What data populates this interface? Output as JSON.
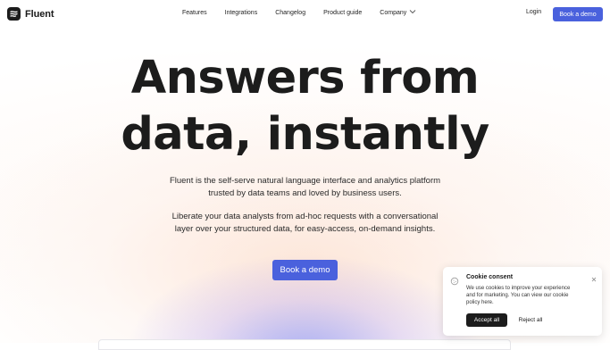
{
  "brand": {
    "name": "Fluent"
  },
  "nav": {
    "links": [
      "Features",
      "Integrations",
      "Changelog",
      "Product guide",
      "Company"
    ],
    "login": "Login",
    "cta": "Book a demo"
  },
  "hero": {
    "title_lines": [
      "Answers from",
      "data, instantly"
    ],
    "paragraph1_lines": [
      "Fluent is the self-serve natural language interface and analytics platform",
      "trusted by data teams and loved by business users."
    ],
    "paragraph2_lines": [
      "Liberate your data analysts from ad-hoc requests with a conversational",
      "layer over your structured data, for easy-access, on-demand insights."
    ],
    "cta": "Book a demo"
  },
  "cookie": {
    "title": "Cookie consent",
    "text_lines": [
      "We use cookies to improve your experience",
      "and for marketing. You can view our cookie",
      "policy here."
    ],
    "accept": "Accept all",
    "reject": "Reject all"
  },
  "colors": {
    "accent": "#4a61dd",
    "dark": "#1c1c1c"
  },
  "icons": {
    "logo": "fluent-logo-icon",
    "company_chevron": "chevron-down-icon",
    "cookie": "cookie-icon",
    "close": "close-icon"
  }
}
